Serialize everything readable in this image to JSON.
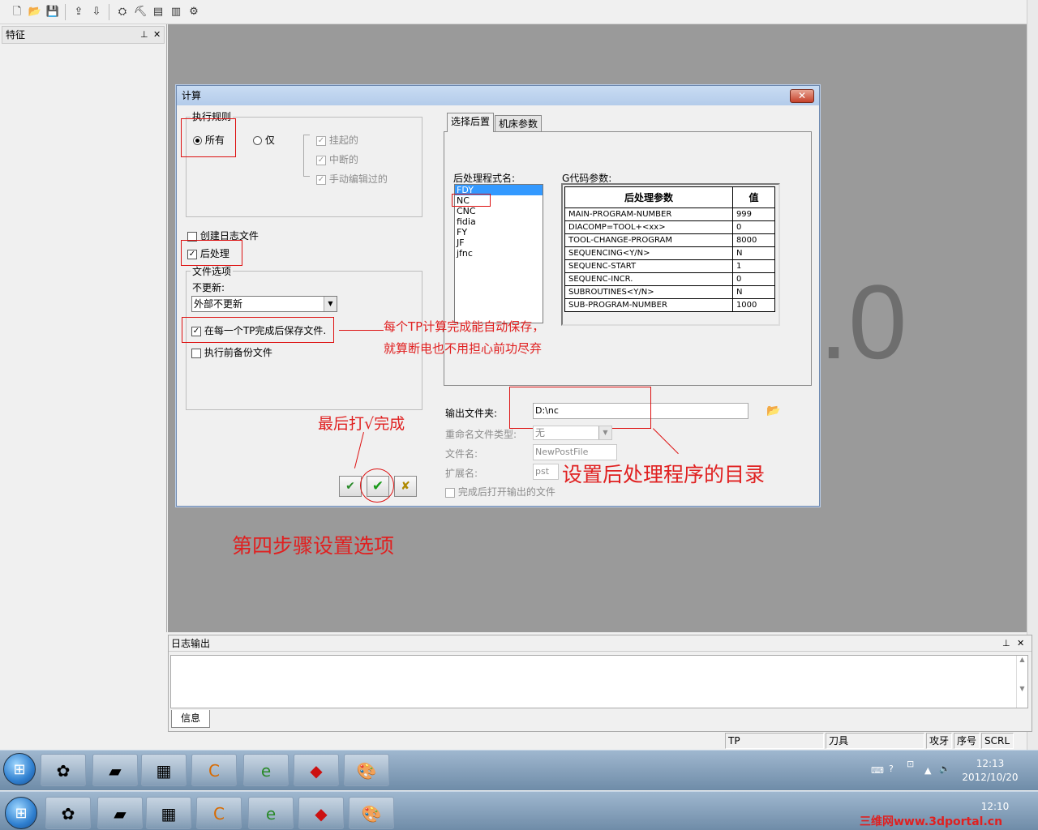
{
  "feature_panel": {
    "title": "特征",
    "pin": "ㅁ",
    "close": "✕"
  },
  "canvas": {
    "big_text": ".0"
  },
  "dialog": {
    "title": "计算",
    "close": "✕",
    "exec_rule": {
      "legend": "执行规则",
      "all_label": "所有",
      "only_label": "仅",
      "opt_suspended": "挂起的",
      "opt_interrupted": "中断的",
      "opt_manual_edited": "手动编辑过的"
    },
    "create_log": "创建日志文件",
    "post_process": "后处理",
    "file_options": {
      "legend": "文件选项",
      "no_update": "不更新:",
      "combo_value": "外部不更新",
      "save_after_tp": "在每一个TP完成后保存文件.",
      "backup_before": "执行前备份文件"
    },
    "tabs": [
      "选择后置",
      "机床参数"
    ],
    "post_names_label": "后处理程式名:",
    "post_names": [
      "FDY",
      "NC",
      "CNC",
      "fidia",
      "FY",
      "JF",
      "jfnc"
    ],
    "gcode_label": "G代码参数:",
    "params_table": {
      "headers": [
        "后处理参数",
        "值"
      ],
      "rows": [
        [
          "MAIN-PROGRAM-NUMBER",
          "999"
        ],
        [
          "DIACOMP=TOOL+<xx>",
          "0"
        ],
        [
          "TOOL-CHANGE-PROGRAM",
          "8000"
        ],
        [
          "SEQUENCING<Y/N>",
          "N"
        ],
        [
          "SEQUENC-START",
          "1"
        ],
        [
          "SEQUENC-INCR.",
          "0"
        ],
        [
          "SUBROUTINES<Y/N>",
          "N"
        ],
        [
          "SUB-PROGRAM-NUMBER",
          "1000"
        ]
      ]
    },
    "output_folder_label": "输出文件夹:",
    "output_folder_value": "D:\\nc",
    "rename_type_label": "重命名文件类型:",
    "rename_type_value": "无",
    "filename_label": "文件名:",
    "filename_value": "NewPostFile",
    "ext_label": "扩展名:",
    "ext_value": "pst",
    "open_after": "完成后打开输出的文件"
  },
  "annotations": {
    "autosave_line1": "每个TP计算完成能自动保存，",
    "autosave_line2": "就算断电也不用担心前功尽弃",
    "finish": "最后打√完成",
    "post_dir": "设置后处理程序的目录",
    "step4": "第四步骤设置选项"
  },
  "log_panel": {
    "title": "日志输出",
    "tab": "信息"
  },
  "statusbar": {
    "tp": "TP",
    "tool": "刀具",
    "tap": "攻牙",
    "seq": "序号",
    "scrl": "SCRL"
  },
  "taskbar1": {
    "time": "12:13",
    "date": "2012/10/20"
  },
  "taskbar2": {
    "time": "12:10"
  },
  "watermark": "三维网www.3dportal.cn"
}
